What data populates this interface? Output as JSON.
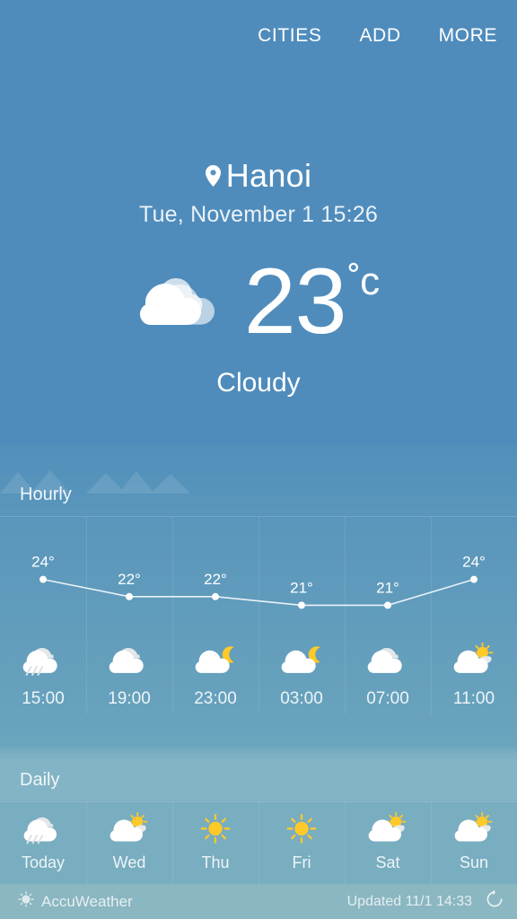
{
  "topnav": {
    "items": [
      {
        "label": "CITIES",
        "name": "nav-cities"
      },
      {
        "label": "ADD",
        "name": "nav-add"
      },
      {
        "label": "MORE",
        "name": "nav-more"
      }
    ]
  },
  "current": {
    "location_icon": "location-pin-icon",
    "city": "Hanoi",
    "datetime": "Tue, November 1 15:26",
    "temperature": "23",
    "unit": "˚c",
    "condition": "Cloudy",
    "condition_icon": "cloudy-icon"
  },
  "sections": {
    "hourly_title": "Hourly",
    "daily_title": "Daily"
  },
  "hourly": {
    "items": [
      {
        "time": "15:00",
        "temp": "24°",
        "icon": "rain-cloud-icon"
      },
      {
        "time": "19:00",
        "temp": "22°",
        "icon": "cloudy-icon"
      },
      {
        "time": "23:00",
        "temp": "22°",
        "icon": "moon-cloud-icon"
      },
      {
        "time": "03:00",
        "temp": "21°",
        "icon": "moon-cloud-icon"
      },
      {
        "time": "07:00",
        "temp": "21°",
        "icon": "cloudy-icon"
      },
      {
        "time": "11:00",
        "temp": "24°",
        "icon": "sun-cloud-icon"
      }
    ]
  },
  "daily": {
    "items": [
      {
        "day": "Today",
        "icon": "rain-cloud-icon"
      },
      {
        "day": "Wed",
        "icon": "sun-cloud-icon"
      },
      {
        "day": "Thu",
        "icon": "sun-icon"
      },
      {
        "day": "Fri",
        "icon": "sun-icon"
      },
      {
        "day": "Sat",
        "icon": "sun-cloud-icon"
      },
      {
        "day": "Sun",
        "icon": "sun-cloud-icon"
      }
    ]
  },
  "footer": {
    "brand": "AccuWeather",
    "brand_icon": "accuweather-sun-logo-icon",
    "updated": "Updated 11/1  14:33",
    "refresh_icon": "refresh-icon"
  },
  "colors": {
    "sky_top": "#4f8cbc",
    "sky_mid": "#5a96bb",
    "panel_bottom": "#79adc0",
    "footer": "#7fb0bb",
    "text": "#ffffff",
    "sun": "#ffc928",
    "moon": "#ffc928",
    "cloud": "#ffffff"
  },
  "chart_data": {
    "type": "line",
    "title": "Hourly temperature",
    "x": [
      "15:00",
      "19:00",
      "23:00",
      "03:00",
      "07:00",
      "11:00"
    ],
    "values": [
      24,
      22,
      22,
      21,
      21,
      24
    ],
    "xlabel": "",
    "ylabel": "°C",
    "ylim": [
      20,
      25
    ],
    "grid": false,
    "legend": "none",
    "point_labels": [
      "24°",
      "22°",
      "22°",
      "21°",
      "21°",
      "24°"
    ],
    "line_color": "#e9f2f7",
    "point_color": "#ffffff"
  }
}
